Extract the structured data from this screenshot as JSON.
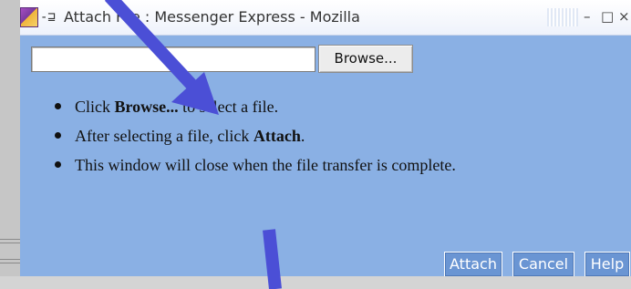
{
  "window": {
    "title": "Attach File : Messenger Express - Mozilla",
    "pin_glyph": "-⊒",
    "controls": {
      "minimize": "–",
      "maximize": "□",
      "close": "×"
    }
  },
  "upload": {
    "file_value": "",
    "browse_label": "Browse..."
  },
  "instructions": [
    {
      "before": "Click ",
      "bold": "Browse...",
      "after": " to select a file."
    },
    {
      "before": "After selecting a file, click ",
      "bold": "Attach",
      "after": "."
    },
    {
      "before": "This window will close when the file transfer is complete.",
      "bold": "",
      "after": ""
    }
  ],
  "actions": {
    "attach": "Attach",
    "cancel": "Cancel",
    "help": "Help"
  },
  "colors": {
    "dialog_background": "#8ab0e4",
    "button_background": "#6a95d3",
    "annotation_arrow": "#4b4fd6"
  },
  "annotations": {
    "arrow_icons": [
      "arrow-to-browse-icon",
      "arrow-to-attach-icon"
    ]
  }
}
